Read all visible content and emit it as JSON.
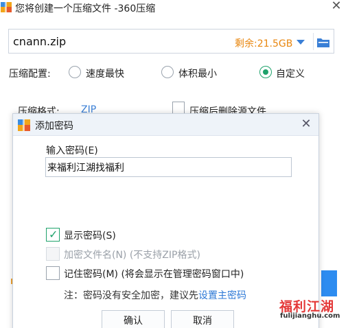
{
  "main_window": {
    "title": "您将创建一个压缩文件 -360压缩",
    "filename": "cnann.zip",
    "space_left": "剩余:21.5GB",
    "config_label": "压缩配置:",
    "options": [
      "速度最快",
      "体积最小",
      "自定义"
    ],
    "selected_option": "自定义",
    "format_label": "压缩格式:",
    "format_value": "ZIP",
    "delete_source_label": "压缩后删除源文件"
  },
  "dialog": {
    "title": "添加密码",
    "password_label": "输入密码(E)",
    "password_value": "来福利江湖找福利",
    "show_password_label": "显示密码(S)",
    "show_password_checked": true,
    "encrypt_names_label": "加密文件名(N) (不支持ZIP格式)",
    "encrypt_names_enabled": false,
    "remember_label": "记住密码(M) (将会显示在管理密码窗口中)",
    "remember_checked": false,
    "note_prefix": "注：密码没有安全加密，建议先",
    "note_link": "设置主密码",
    "ok_label": "确认",
    "cancel_label": "取消"
  },
  "watermark": {
    "brand": "福利江湖",
    "url": "fulijianghu.com"
  },
  "colors": {
    "accent_green": "#1ea26b",
    "link_blue": "#2d79d6",
    "space_orange": "#e8860e",
    "dropdown_blue": "#3a7fd6"
  }
}
